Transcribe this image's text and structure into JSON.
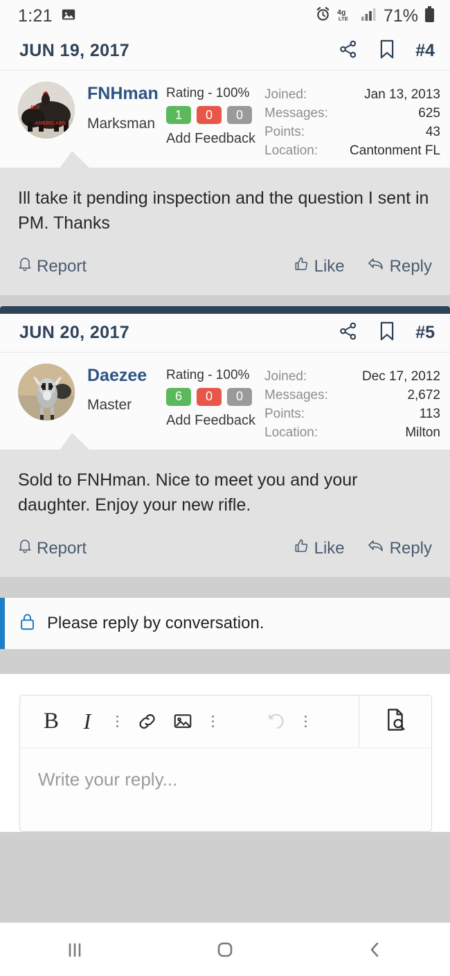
{
  "status_bar": {
    "time": "1:21",
    "battery_percent": "71%",
    "icons": [
      "image-icon",
      "alarm-icon",
      "lte-4g-icon",
      "signal-bars-icon",
      "battery-icon"
    ]
  },
  "posts": [
    {
      "date": "JUN 19, 2017",
      "post_number": "#4",
      "share_icon": "share-icon",
      "bookmark_icon": "bookmark-icon",
      "user": {
        "name": "FNHman",
        "title": "Marksman",
        "avatar": "avatar-atf-americans",
        "rating": "Rating - 100%",
        "feedback": {
          "positive": "1",
          "negative": "0",
          "neutral": "0"
        },
        "add_feedback": "Add Feedback",
        "stats": [
          {
            "label": "Joined:",
            "value": "Jan 13, 2013"
          },
          {
            "label": "Messages:",
            "value": "625"
          },
          {
            "label": "Points:",
            "value": "43"
          },
          {
            "label": "Location:",
            "value": "Cantonment FL"
          }
        ]
      },
      "message": "Ill take it pending inspection and the question I sent in PM. Thanks",
      "actions": {
        "report": "Report",
        "like": "Like",
        "reply": "Reply"
      }
    },
    {
      "date": "JUN 20, 2017",
      "post_number": "#5",
      "share_icon": "share-icon",
      "bookmark_icon": "bookmark-icon",
      "user": {
        "name": "Daezee",
        "title": "Master",
        "avatar": "avatar-goat",
        "rating": "Rating - 100%",
        "feedback": {
          "positive": "6",
          "negative": "0",
          "neutral": "0"
        },
        "add_feedback": "Add Feedback",
        "stats": [
          {
            "label": "Joined:",
            "value": "Dec 17, 2012"
          },
          {
            "label": "Messages:",
            "value": "2,672"
          },
          {
            "label": "Points:",
            "value": "113"
          },
          {
            "label": "Location:",
            "value": "Milton"
          }
        ]
      },
      "message": "Sold to FNHman. Nice to meet you and your daughter. Enjoy your new rifle.",
      "actions": {
        "report": "Report",
        "like": "Like",
        "reply": "Reply"
      }
    }
  ],
  "notice": {
    "text": "Please reply by conversation.",
    "icon": "lock-icon"
  },
  "editor": {
    "placeholder": "Write your reply...",
    "toolbar": {
      "bold": "B",
      "italic": "I",
      "link_icon": "link-icon",
      "image_icon": "image-icon",
      "undo_icon": "undo-icon",
      "preview_icon": "document-search-icon",
      "overflow_icon": "vertical-dots-icon"
    }
  },
  "nav_bar": {
    "recents": "recents-icon",
    "home": "home-icon",
    "back": "back-icon"
  },
  "colors": {
    "accent_navy": "#2e4258",
    "link_blue": "#2c5484",
    "notice_blue": "#1f7fc4",
    "positive_green": "#5cb85c",
    "negative_red": "#e8564a",
    "neutral_grey": "#9a9a9a"
  }
}
